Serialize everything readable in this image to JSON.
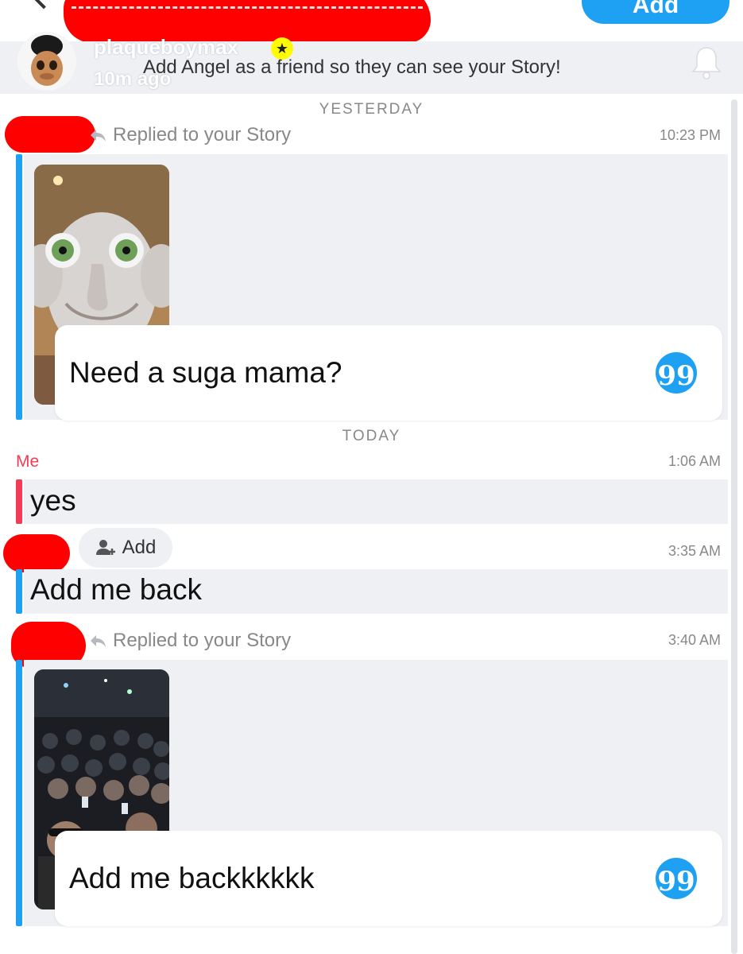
{
  "header": {
    "username": "plaqueboymax",
    "time_ago": "10m ago",
    "add_button_label": "Add",
    "banner_text": "Add Angel as a friend so they can see your Story!"
  },
  "colors": {
    "accent_blue": "#1ea1f2",
    "me_red": "#f23c57",
    "redaction": "#ff0000",
    "message_bg": "#eef0f4"
  },
  "chat": {
    "yesterday_label": "YESTERDAY",
    "today_label": "TODAY",
    "messages": [
      {
        "type": "story_reply",
        "label": "Replied to your Story",
        "time": "10:23 PM",
        "text": "Need a suga mama?"
      },
      {
        "type": "text",
        "sender": "Me",
        "time": "1:06 AM",
        "text": "yes"
      },
      {
        "type": "text",
        "add_label": "Add",
        "time": "3:35 AM",
        "text": "Add me back"
      },
      {
        "type": "story_reply",
        "label": "Replied to your Story",
        "time": "3:40 AM",
        "text": "Add me backkkkkk"
      }
    ]
  }
}
